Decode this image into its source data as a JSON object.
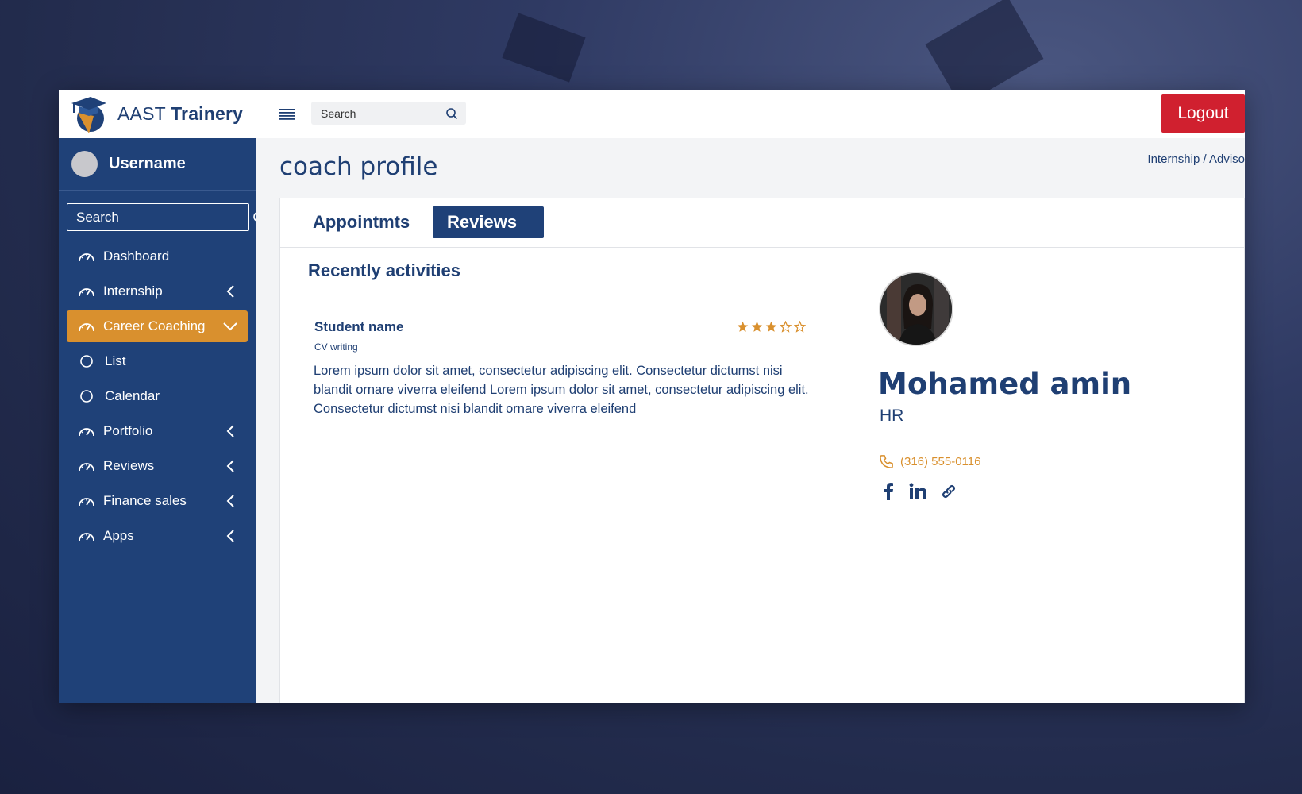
{
  "app": {
    "brand_prefix": "AAST",
    "brand_name": "Trainery"
  },
  "topbar": {
    "search_placeholder": "Search",
    "logout_label": "Logout"
  },
  "sidebar": {
    "username": "Username",
    "search_placeholder": "Search",
    "items": [
      {
        "label": "Dashboard",
        "icon": "gauge-icon"
      },
      {
        "label": "Internship",
        "icon": "gauge-icon"
      },
      {
        "label": "Career Coaching",
        "icon": "gauge-icon",
        "active": true
      },
      {
        "label": "List",
        "icon": "circle-icon"
      },
      {
        "label": "Calendar",
        "icon": "circle-icon"
      },
      {
        "label": "Portfolio",
        "icon": "gauge-icon"
      },
      {
        "label": "Reviews",
        "icon": "gauge-icon"
      },
      {
        "label": "Finance sales",
        "icon": "gauge-icon"
      },
      {
        "label": "Apps",
        "icon": "gauge-icon"
      }
    ]
  },
  "page": {
    "title": "coach profile",
    "breadcrumb": "Internship / Adviso"
  },
  "tabs": [
    {
      "label": "Appointmts"
    },
    {
      "label": "Reviews",
      "active": true
    }
  ],
  "activities": {
    "title": "Recently activities",
    "review": {
      "student": "Student name",
      "tag": "CV writing",
      "rating": 3,
      "max_rating": 5,
      "body": "Lorem ipsum dolor sit amet, consectetur adipiscing elit. Consectetur dictumst nisi blandit ornare viverra eleifend Lorem ipsum dolor sit amet, consectetur adipiscing elit. Consectetur dictumst nisi blandit ornare viverra eleifend"
    }
  },
  "profile": {
    "name": "Mohamed amin",
    "role": "HR",
    "phone": "(316) 555-0116",
    "socials": [
      "facebook-icon",
      "linkedin-icon",
      "link-icon"
    ]
  },
  "colors": {
    "primary": "#1f4178",
    "accent": "#d9902e",
    "danger": "#d0202f"
  }
}
